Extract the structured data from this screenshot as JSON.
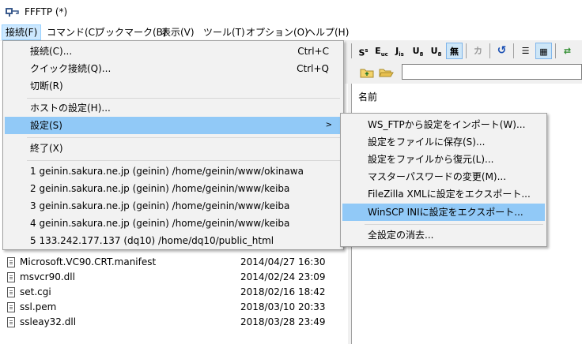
{
  "window": {
    "title": "FFFTP (*)"
  },
  "menubar": [
    {
      "label": "接続(F)",
      "active": true
    },
    {
      "label": "コマンド(C)"
    },
    {
      "label": "ブックマーク(B)"
    },
    {
      "label": "表示(V)"
    },
    {
      "label": "ツール(T)"
    },
    {
      "label": "オプション(O)"
    },
    {
      "label": "ヘルプ(H)"
    }
  ],
  "toolbar": {
    "buttons": [
      {
        "icon": "sjis-icon",
        "label": "S"
      },
      {
        "icon": "euc-icon",
        "label": "E"
      },
      {
        "icon": "jis-icon",
        "label": "J"
      },
      {
        "icon": "utf8n-icon",
        "label": "U"
      },
      {
        "icon": "utf8bom-icon",
        "label": "U"
      },
      {
        "icon": "no-convert-icon",
        "label": "無",
        "pressed": true
      },
      {
        "icon": "kana-icon",
        "label": "カ"
      },
      {
        "icon": "refresh-icon",
        "label": "↺"
      },
      {
        "icon": "list-view-icon",
        "label": "☰"
      },
      {
        "icon": "detail-view-icon",
        "label": "▦",
        "pressed": true
      },
      {
        "icon": "sync-icon",
        "label": "⇄"
      }
    ]
  },
  "remote_panel": {
    "column_name": "名前"
  },
  "local_files": [
    {
      "name": "Microsoft.VC90.CRT.manifest",
      "date": "2014/04/27 16:30"
    },
    {
      "name": "msvcr90.dll",
      "date": "2014/02/24 23:09"
    },
    {
      "name": "set.cgi",
      "date": "2018/02/16 18:42"
    },
    {
      "name": "ssl.pem",
      "date": "2018/03/10 20:33"
    },
    {
      "name": "ssleay32.dll",
      "date": "2018/03/28 23:49"
    }
  ],
  "connect_menu": {
    "items": [
      {
        "label": "接続(C)...",
        "shortcut": "Ctrl+C"
      },
      {
        "label": "クイック接続(Q)...",
        "shortcut": "Ctrl+Q"
      },
      {
        "label": "切断(R)",
        "shortcut": ""
      },
      {
        "label": "ホストの設定(H)...",
        "shortcut": ""
      },
      {
        "label": "設定(S)",
        "shortcut": "",
        "submenu": true,
        "highlighted": true
      },
      {
        "label": "終了(X)",
        "shortcut": ""
      },
      {
        "label": "1 geinin.sakura.ne.jp (geinin) /home/geinin/www/okinawa"
      },
      {
        "label": "2 geinin.sakura.ne.jp (geinin) /home/geinin/www/keiba"
      },
      {
        "label": "3 geinin.sakura.ne.jp (geinin) /home/geinin/www/keiba"
      },
      {
        "label": "4 geinin.sakura.ne.jp (geinin) /home/geinin/www/keiba"
      },
      {
        "label": "5 133.242.177.137 (dq10) /home/dq10/public_html"
      }
    ]
  },
  "settings_submenu": {
    "items": [
      {
        "label": "WS_FTPから設定をインポート(W)..."
      },
      {
        "label": "設定をファイルに保存(S)..."
      },
      {
        "label": "設定をファイルから復元(L)..."
      },
      {
        "label": "マスターパスワードの変更(M)..."
      },
      {
        "label": "FileZilla XMLに設定をエクスポート..."
      },
      {
        "label": "WinSCP INIに設定をエクスポート...",
        "highlighted": true
      },
      {
        "label": "全設定の消去..."
      }
    ]
  }
}
